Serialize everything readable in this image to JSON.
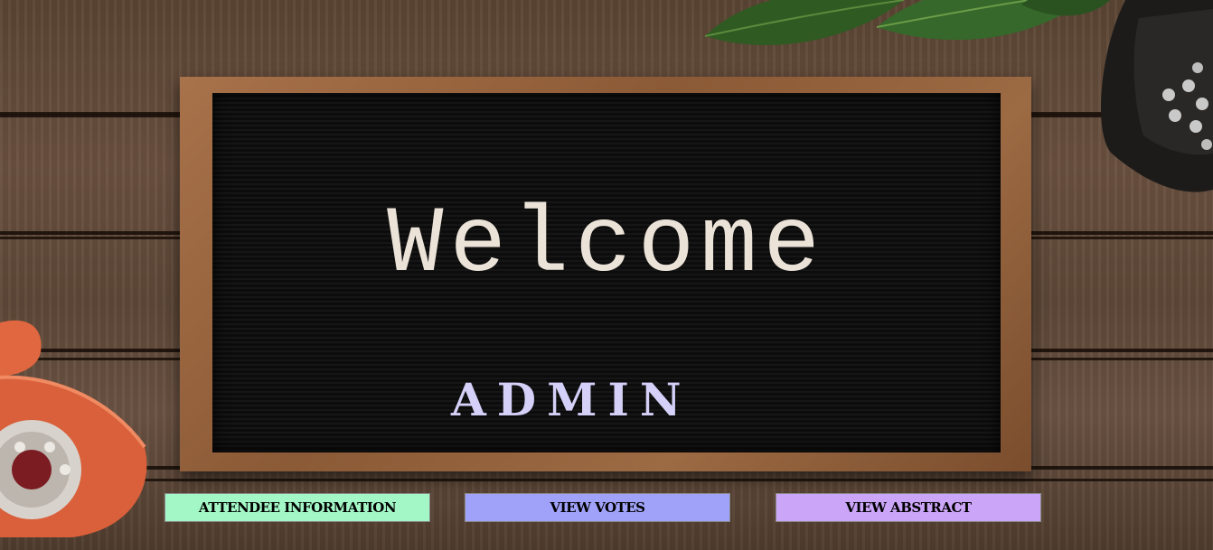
{
  "board": {
    "welcome": "Welcome",
    "role": "ADMIN"
  },
  "buttons": [
    {
      "label": "ATTENDEE INFORMATION",
      "color": "#a3f7c7"
    },
    {
      "label": "VIEW VOTES",
      "color": "#a0a2f9"
    },
    {
      "label": "VIEW ABSTRACT",
      "color": "#cba5f8"
    }
  ],
  "colors": {
    "welcome_text": "#ece3d8",
    "admin_text": "#d4d0f8",
    "board": "#111111",
    "frame": "#9c6a43",
    "wood": "#5e4838"
  },
  "decorations": [
    "plant-leaves",
    "rotary-phone",
    "typewriter"
  ]
}
